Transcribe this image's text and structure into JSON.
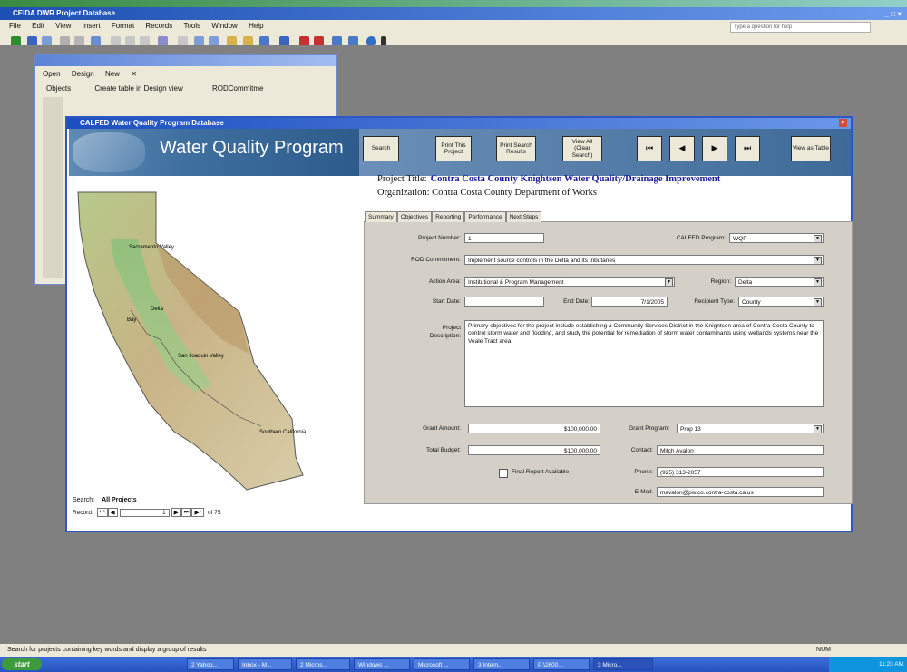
{
  "access": {
    "title": "CEIDA DWR Project Database",
    "window_buttons": "_ □ ×",
    "menu": [
      "File",
      "Edit",
      "View",
      "Insert",
      "Format",
      "Records",
      "Tools",
      "Window",
      "Help"
    ],
    "help_placeholder": "Type a question for help"
  },
  "db_window": {
    "title": "",
    "toolbar": [
      "Open",
      "Design",
      "New"
    ],
    "objects_label": "Objects",
    "create_item": "Create table in Design view",
    "tab2": "RODCommitme"
  },
  "form": {
    "title": "CALFED Water Quality Program Database",
    "banner_heading": "Water Quality Program",
    "buttons": {
      "search": "Search",
      "print_project": "Print This Project",
      "print_search": "Print Search Results",
      "view_all": "View All (Clear Search)",
      "first": "⏮",
      "prev": "◀",
      "next": "▶",
      "last": "⏭",
      "view_table": "View as Table"
    },
    "project_title_label": "Project Title:",
    "project_title": "Contra Costa County Knightsen Water Quality/Drainage Improvement",
    "organization_label": "Organization:",
    "organization": "Contra Costa County Department of Works",
    "tabs": [
      "Summary",
      "Objectives",
      "Reporting",
      "Performance",
      "Next Steps"
    ],
    "fields": {
      "project_number_label": "Project Number:",
      "project_number": "1",
      "calfed_program_label": "CALFED Program:",
      "calfed_program": "WQP",
      "rod_label": "ROD Commitment:",
      "rod": "Implement source controls in the Delta and its tributaries",
      "action_area_label": "Action Area:",
      "action_area": "Institutional & Program Management",
      "region_label": "Region:",
      "region": "Delta",
      "start_date_label": "Start Date:",
      "start_date": "",
      "end_date_label": "End Date:",
      "end_date": "7/1/2005",
      "recipient_type_label": "Recipient Type:",
      "recipient_type": "County",
      "description_label": "Project Description:",
      "description": "Primary objectives for the project include establishing a Community Services District in the Knightsen area of Contra Costa County to control storm water and flooding, and study the potential for remediation of storm water contaminants using wetlands systems near the Veale Tract area.",
      "grant_amount_label": "Grant Amount:",
      "grant_amount": "$100,000.00",
      "grant_program_label": "Grant Program:",
      "grant_program": "Prop 13",
      "total_budget_label": "Total Budget:",
      "total_budget": "$100,000.00",
      "contact_label": "Contact:",
      "contact": "Mitch Avalon",
      "final_report_label": "Final Report Available",
      "phone_label": "Phone:",
      "phone": "(925) 313-2057",
      "email_label": "E-Mail:",
      "email": "mavalon@pw.co.contra-costa.ca.us"
    },
    "map_labels": {
      "sacramento": "Sacramento Valley",
      "delta": "Delta",
      "bay": "Bay",
      "san_joaquin": "San Joaquin Valley",
      "southern": "Southern California"
    },
    "search_label": "Search:",
    "search_value": "All Projects",
    "record_label": "Record:",
    "record_value": "1",
    "record_total": "of 75"
  },
  "status": {
    "text": "Search for projects containing key words and display a group of results",
    "num": "NUM"
  },
  "taskbar": {
    "start": "start",
    "items": [
      "2 Yahoo... ",
      "Inbox - M...",
      "2 Micros...",
      "Windows ...",
      "Microsoft ...",
      "3 Intern...",
      "P:\\2600...",
      "3 Micro..."
    ],
    "clock": "11:23 AM"
  }
}
